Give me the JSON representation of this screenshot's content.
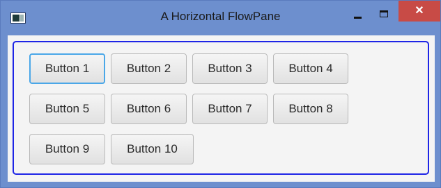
{
  "window": {
    "title": "A Horizontal FlowPane",
    "icon": "application-window-icon",
    "controls": {
      "minimize": "minimize-icon",
      "maximize": "maximize-icon",
      "close_label": "✕"
    }
  },
  "flowpane": {
    "orientation": "horizontal",
    "border_color": "#1e25e6",
    "focused_button": "Button 1",
    "buttons": [
      "Button 1",
      "Button 2",
      "Button 3",
      "Button 4",
      "Button 5",
      "Button 6",
      "Button 7",
      "Button 8",
      "Button 9",
      "Button 10"
    ]
  },
  "colors": {
    "window_frame": "#6d8fce",
    "close_button": "#c84b46",
    "focus_ring": "#4aa7e8"
  }
}
